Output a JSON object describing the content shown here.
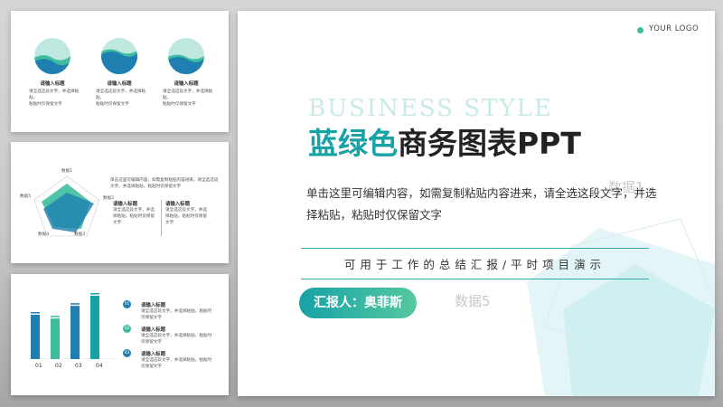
{
  "colors": {
    "teal": "#17a2a6",
    "blue": "#1f7fb0",
    "green": "#3dbd9e",
    "light": "#bfe8e0"
  },
  "thumb1": {
    "items": [
      {
        "title": "请输入标题",
        "desc_line1": "请全选这段文字，并选择粘贴，",
        "desc_line2": "粘贴时仅保留文字"
      },
      {
        "title": "请输入标题",
        "desc_line1": "请全选这段文字，并选择粘贴，",
        "desc_line2": "粘贴时仅保留文字"
      },
      {
        "title": "请输入标题",
        "desc_line1": "请全选这段文字，并选择粘贴，",
        "desc_line2": "粘贴时仅保留文字"
      }
    ]
  },
  "thumb2": {
    "radar_labels": [
      "数据1",
      "数据2",
      "数据3",
      "数据4",
      "数据5"
    ],
    "intro_line1": "单击这里可编辑内容，如需复制粘贴内容进来，请全选这段",
    "intro_line2": "文字，并选择粘贴，粘贴时仅保留文字",
    "blocks": [
      {
        "title": "请输入标题",
        "desc_line1": "请全选这段文字，并选",
        "desc_line2": "择粘贴，粘贴时仅保留",
        "desc_line3": "文字"
      },
      {
        "title": "请输入标题",
        "desc_line1": "请全选这段文字，并选",
        "desc_line2": "择粘贴，粘贴时仅保留",
        "desc_line3": "文字"
      }
    ]
  },
  "thumb3": {
    "categories": [
      "01",
      "02",
      "03",
      "04"
    ],
    "values": [
      35,
      32,
      42,
      50
    ],
    "max": 50,
    "list": [
      {
        "num": "01",
        "title": "请输入标题",
        "desc_line1": "请全选这段文字，并选择粘贴，粘贴时",
        "desc_line2": "仅保留文字"
      },
      {
        "num": "02",
        "title": "请输入标题",
        "desc_line1": "请全选这段文字，并选择粘贴，粘贴时",
        "desc_line2": "仅保留文字"
      },
      {
        "num": "03",
        "title": "请输入标题",
        "desc_line1": "请全选这段文字，并选择粘贴，粘贴时",
        "desc_line2": "仅保留文字"
      }
    ]
  },
  "main": {
    "logo": "YOUR LOGO",
    "bg_word": "BUSINESS STYLE",
    "title_accent": "蓝绿色",
    "title_rest": "商务图表PPT",
    "body": "单击这里可编辑内容，如需复制粘贴内容进来，请全选这段文字，并选择粘贴，粘贴时仅保留文字",
    "subtitle": "可用于工作的总结汇报/平时项目演示",
    "reporter": "汇报人：奥菲斯",
    "ghost1": "数据1",
    "ghost2": "数据5"
  }
}
